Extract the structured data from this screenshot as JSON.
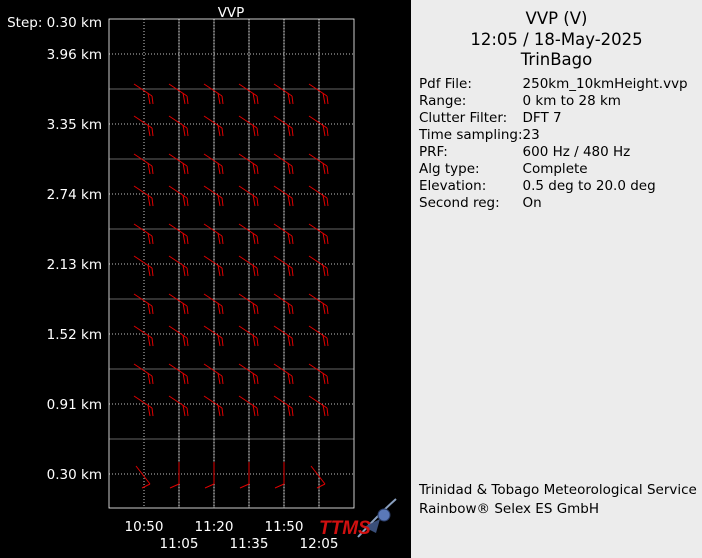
{
  "chart_data": {
    "type": "vvp-wind-barbs",
    "title": "VVP",
    "step_label": "Step: 0.30 km",
    "y_tick_labels": [
      "3.96 km",
      "3.35 km",
      "2.74 km",
      "2.13 km",
      "1.52 km",
      "0.91 km",
      "0.30 km"
    ],
    "heights_km": [
      3.96,
      3.35,
      2.74,
      2.13,
      1.52,
      0.91,
      0.3
    ],
    "x_times": [
      "10:50",
      "11:05",
      "11:20",
      "11:35",
      "11:50",
      "12:05"
    ],
    "x_tick_labels_top_row": [
      "10:50",
      "11:20",
      "11:50"
    ],
    "x_tick_labels_bottom_row": [
      "11:05",
      "11:35",
      "12:05"
    ],
    "grid": true,
    "barb_color": "#e00000",
    "axis_color": "#ffffff"
  },
  "info": {
    "title_line1": "VVP (V)",
    "title_line2": "12:05 / 18-May-2025",
    "title_line3": "TrinBago",
    "rows": [
      {
        "key": "Pdf File:",
        "value": "250km_10kmHeight.vvp"
      },
      {
        "key": "Range:",
        "value": "0 km to 28 km"
      },
      {
        "key": "Clutter Filter:",
        "value": "DFT 7"
      },
      {
        "key": "Time sampling:",
        "value": "23"
      },
      {
        "key": "PRF:",
        "value": "600 Hz / 480 Hz"
      },
      {
        "key": "Alg type:",
        "value": "Complete"
      },
      {
        "key": "Elevation:",
        "value": "0.5 deg to 20.0 deg"
      },
      {
        "key": "Second reg:",
        "value": "On"
      }
    ],
    "footer_line1": "Trinidad & Tobago Meteorological Service",
    "footer_line2": "Rainbow® Selex ES GmbH"
  },
  "logo": {
    "text": "TTMS",
    "color": "#d01010"
  }
}
